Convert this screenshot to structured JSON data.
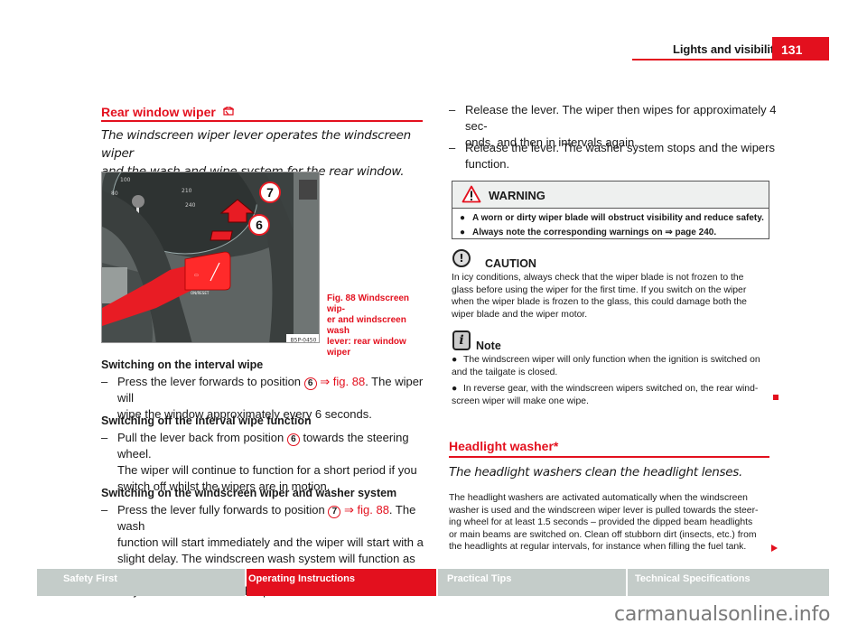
{
  "header": {
    "chapter_title": "Lights and visibility",
    "page_number": "131"
  },
  "left": {
    "section_title": "Rear window wiper",
    "section_icon": "rear-wiper-icon",
    "lead_line1": "The windscreen wiper lever operates the windscreen wiper",
    "lead_line2": "and the wash and wipe system for the rear window.",
    "figure": {
      "label_7": "7",
      "label_6": "6",
      "code": "B5P-0450",
      "caption_line1": "Fig. 88   Windscreen wip-",
      "caption_line2": "er and windscreen wash",
      "caption_line3": "lever: rear window wiper"
    },
    "sub1": {
      "heading": "Switching on the interval wipe",
      "dash": "–",
      "pre": "Press the lever forwards to position ",
      "pos": "6",
      "ref": " ⇒ fig. 88",
      "post": ". The wiper will",
      "line2": "wipe the window approximately every 6 seconds."
    },
    "sub2": {
      "heading": "Switching off the interval wipe function",
      "dash": "–",
      "pre": "Pull the lever back from position ",
      "pos": "6",
      "post": " towards the steering wheel.",
      "line2": "The wiper will continue to function for a short period if you",
      "line3": "switch off whilst the wipers are in motion."
    },
    "sub3": {
      "heading": "Switching on the windscreen wiper and washer system",
      "dash": "–",
      "pre": "Press the lever fully forwards to position ",
      "pos": "7",
      "ref": " ⇒ fig. 88",
      "post": ". The wash",
      "line2": "function will start immediately and the wiper will start with a",
      "line3": "slight delay. The windscreen wash system will function as long",
      "line4": "as you hold the lever in this position."
    }
  },
  "right": {
    "steps": [
      {
        "dash": "–",
        "line1": "Release the lever. The wiper then wipes for approximately 4 sec-",
        "line2": "onds, and then in intervals again."
      },
      {
        "dash": "–",
        "line1": "Release the lever. The washer system stops and the wipers",
        "line2": "function."
      }
    ],
    "warning": {
      "title": "WARNING",
      "bullet": "●",
      "items": [
        "A worn or dirty wiper blade will obstruct visibility and reduce safety.",
        "Always note the corresponding warnings on ⇒ page 240."
      ]
    },
    "caution": {
      "icon_glyph": "!",
      "title": "CAUTION",
      "lines": [
        "In icy conditions, always check that the wiper blade is not frozen to the",
        "glass before using the wiper for the first time. If you switch on the wiper",
        "when the wiper blade is frozen to the glass, this could damage both the",
        "wiper blade and the wiper motor."
      ]
    },
    "note": {
      "icon_glyph": "i",
      "title": "Note",
      "bullet": "●",
      "item1_line1": "The windscreen wiper will only function when the ignition is switched on",
      "item1_line2": "and the tailgate is closed.",
      "item2_line1": "In reverse gear, with the windscreen wipers switched on, the rear wind-",
      "item2_line2": "screen wiper will make one wipe."
    },
    "section2_title": "Headlight washer*",
    "section2_lead": "The headlight washers clean the headlight lenses.",
    "section2_body": [
      "The headlight washers are activated automatically when the windscreen",
      "washer is used and the windscreen wiper lever is pulled towards the steer-",
      "ing wheel for at least 1.5 seconds – provided the dipped beam headlights",
      "or main beams are switched on. Clean off stubborn dirt (insects, etc.) from",
      "the headlights at regular intervals, for instance when filling the fuel tank."
    ]
  },
  "footer": {
    "tabs": [
      {
        "label": "Safety First",
        "active": false
      },
      {
        "label": "Operating Instructions",
        "active": true
      },
      {
        "label": "Practical Tips",
        "active": false
      },
      {
        "label": "Technical Specifications",
        "active": false
      }
    ],
    "watermark": "carmanualsonline.info"
  },
  "colors": {
    "accent": "#e3101e",
    "tab_inactive": "#c4ccc9",
    "text": "#1a1a1a"
  }
}
